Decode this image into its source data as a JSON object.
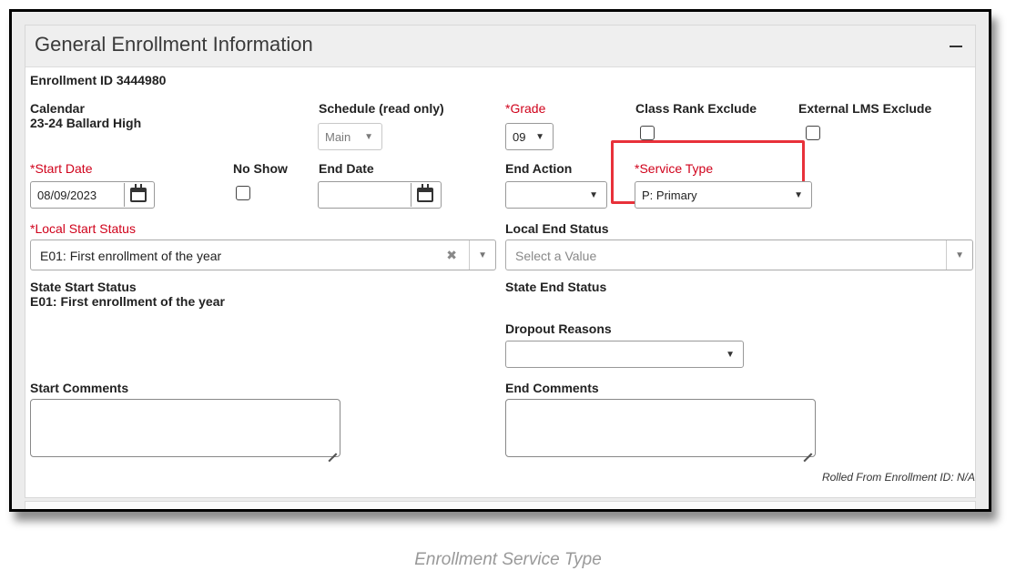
{
  "panel": {
    "title": "General Enrollment Information"
  },
  "enrollment_id": "Enrollment ID 3444980",
  "calendar": {
    "label": "Calendar",
    "value": "23-24 Ballard High"
  },
  "schedule": {
    "label": "Schedule (read only)",
    "value": "Main"
  },
  "grade": {
    "label": "*Grade",
    "value": "09"
  },
  "class_rank_exclude": {
    "label": "Class Rank Exclude",
    "checked": false
  },
  "external_lms_exclude": {
    "label": "External LMS Exclude",
    "checked": false
  },
  "start_date": {
    "label": "*Start Date",
    "value": "08/09/2023"
  },
  "no_show": {
    "label": "No Show",
    "checked": false
  },
  "end_date": {
    "label": "End Date",
    "value": ""
  },
  "end_action": {
    "label": "End Action",
    "value": ""
  },
  "service_type": {
    "label": "*Service Type",
    "value": "P: Primary"
  },
  "local_start_status": {
    "label": "*Local Start Status",
    "value": "E01: First enrollment of the year"
  },
  "local_end_status": {
    "label": "Local End Status",
    "placeholder": "Select a Value"
  },
  "state_start_status": {
    "label": "State Start Status",
    "value": "E01: First enrollment of the year"
  },
  "state_end_status": {
    "label": "State End Status"
  },
  "dropout_reasons": {
    "label": "Dropout Reasons",
    "value": ""
  },
  "start_comments": {
    "label": "Start Comments"
  },
  "end_comments": {
    "label": "End Comments"
  },
  "rolled_from": "Rolled From Enrollment ID: N/A",
  "caption": "Enrollment Service Type",
  "glyphs": {
    "arrow": "▼",
    "clear": "✖"
  },
  "colors": {
    "required": "#d0021b",
    "highlight": "#e8313a"
  },
  "icons": [
    "minus-icon",
    "calendar-icon",
    "chevron-down-icon",
    "clear-icon",
    "resize-grip-icon"
  ]
}
